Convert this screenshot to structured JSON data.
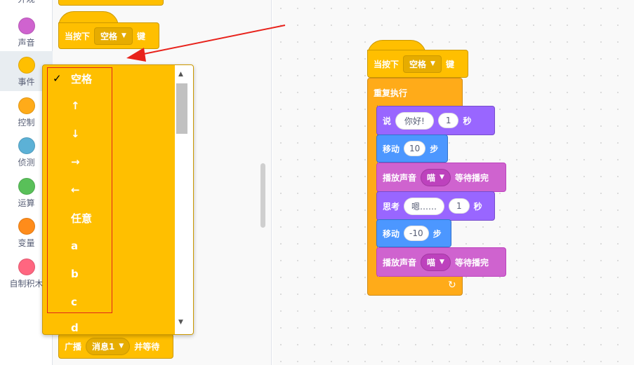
{
  "sidebar": {
    "categories": [
      {
        "label": "外观",
        "color": "#9966ff"
      },
      {
        "label": "声音",
        "color": "#cf63cf"
      },
      {
        "label": "事件",
        "color": "#ffbf00"
      },
      {
        "label": "控制",
        "color": "#ffab19"
      },
      {
        "label": "侦测",
        "color": "#5cb1d6"
      },
      {
        "label": "运算",
        "color": "#59c059"
      },
      {
        "label": "变量",
        "color": "#ff8c1a"
      },
      {
        "label": "自制积木",
        "color": "#ff6680"
      }
    ]
  },
  "palette": {
    "when_key_prefix": "当按下",
    "when_key_value": "空格",
    "when_key_suffix": "键",
    "broadcast_label": "广播",
    "broadcast_value": "消息1",
    "broadcast_suffix": "并等待"
  },
  "dropdown": {
    "check": "✓",
    "items": [
      "空格",
      "↑",
      "↓",
      "→",
      "←",
      "任意",
      "a",
      "b",
      "c",
      "d"
    ]
  },
  "script": {
    "hat_prefix": "当按下",
    "hat_value": "空格",
    "hat_suffix": "键",
    "forever_label": "重复执行",
    "say_label": "说",
    "say_text": "你好!",
    "say_secs": "1",
    "secs_label": "秒",
    "move_label": "移动",
    "move1_value": "10",
    "steps_label": "步",
    "play_label": "播放声音",
    "sound_value": "喵",
    "until_done": "等待播完",
    "think_label": "思考",
    "think_text": "嗯……",
    "think_secs": "1",
    "move2_value": "-10",
    "loop_icon": "↻"
  }
}
